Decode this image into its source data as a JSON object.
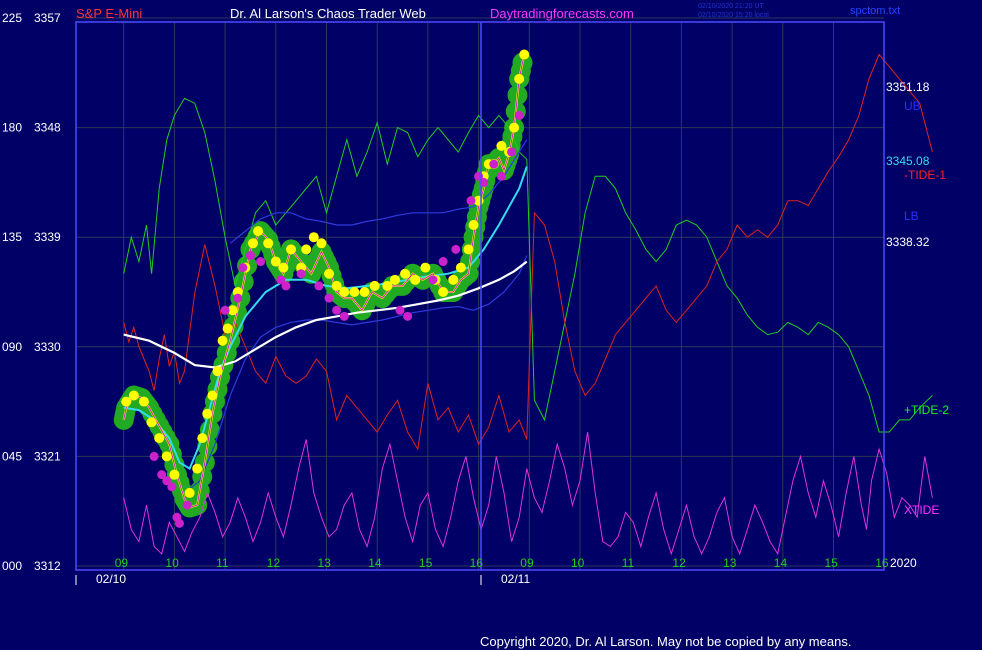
{
  "header": {
    "instrument": "S&P E-Mini",
    "site_title": "Dr. Al Larson's Chaos Trader Web",
    "site_url": "Daytradingforecasts.com",
    "timestamp_line1": "02/10/2020 21:20 UT",
    "timestamp_line2": "02/10/2020 15:20 local",
    "file_name": "spctom.txt"
  },
  "footer": {
    "copyright": "Copyright 2020, Dr. Al Larson. May not be copied by any means."
  },
  "colors": {
    "background": "#000066",
    "grid": "#2a3a5a",
    "axis": "#4b4bff",
    "price": "#ffff00",
    "bubble": "#22aa22",
    "ema_fast": "#33ddee",
    "ema_slow": "#ffffff",
    "band": "#2d3bdd",
    "tide_plus": "#22cc22",
    "tide_minus": "#dd2222",
    "xtide": "#dd33dd",
    "magenta_marker": "#cc22cc"
  },
  "chart_data": {
    "type": "line",
    "left_axis_osc": [
      "225",
      "180",
      "135",
      "090",
      "045",
      "000"
    ],
    "left_axis_price": [
      "3357",
      "3348",
      "3339",
      "3330",
      "3321",
      "3312"
    ],
    "ylim_price": [
      3312,
      3357
    ],
    "ylim_osc": [
      0,
      225
    ],
    "x_hours_day1": [
      "09",
      "10",
      "11",
      "12",
      "13",
      "14",
      "15",
      "16"
    ],
    "x_hours_day2": [
      "09",
      "10",
      "11",
      "12",
      "13",
      "14",
      "15",
      "16"
    ],
    "date_labels": [
      "02/10",
      "02/11"
    ],
    "year_label": "2020",
    "right_labels": {
      "upper_band_value": "3351.18",
      "upper_band_name": "UB",
      "mid_value": "3345.08",
      "tide_minus_name": "-TIDE-1",
      "lower_band_name": "LB",
      "lower_band_value": "3338.32",
      "tide_plus_name": "+TIDE-2",
      "xtide_name": "XTIDE"
    },
    "series": [
      {
        "key": "price",
        "x": [
          0,
          0.05,
          0.2,
          0.35,
          0.5,
          0.7,
          0.9,
          1.05,
          1.2,
          1.3,
          1.45,
          1.6,
          1.75,
          1.9,
          2.1,
          2.3,
          2.5,
          2.7,
          2.85,
          3.0,
          3.15,
          3.3,
          3.5,
          3.7,
          3.9,
          4.05,
          4.2,
          4.35,
          4.5,
          4.7,
          4.9,
          5.1,
          5.3,
          5.5,
          5.7,
          5.9,
          6.1,
          6.3,
          6.5,
          6.65,
          6.8,
          6.9,
          7.0,
          7.1,
          7.2,
          7.3,
          7.4,
          7.5,
          7.6,
          7.7,
          7.8,
          7.9
        ],
        "values": [
          3324.0,
          3325.0,
          3326.0,
          3325.8,
          3325.0,
          3323.5,
          3322.0,
          3319.5,
          3317.5,
          3316.8,
          3317.0,
          3320.5,
          3324.5,
          3327.5,
          3330.5,
          3334.0,
          3338.0,
          3339.5,
          3338.8,
          3337.0,
          3336.0,
          3338.0,
          3337.0,
          3336.0,
          3337.8,
          3336.5,
          3334.5,
          3334.0,
          3334.0,
          3333.0,
          3334.5,
          3334.0,
          3335.0,
          3335.0,
          3336.0,
          3335.5,
          3336.0,
          3334.5,
          3334.5,
          3335.5,
          3336.0,
          3339.0,
          3341.5,
          3343.0,
          3345.0,
          3345.0,
          3345.5,
          3344.5,
          3345.8,
          3348.0,
          3352.0,
          3354.0
        ]
      },
      {
        "key": "ema_fast",
        "x": [
          0,
          0.3,
          0.6,
          0.9,
          1.1,
          1.3,
          1.5,
          1.7,
          1.9,
          2.1,
          2.4,
          2.8,
          3.2,
          3.6,
          4.0,
          4.4,
          4.8,
          5.2,
          5.6,
          6.0,
          6.4,
          6.8,
          7.1,
          7.4,
          7.6,
          7.8,
          7.95
        ],
        "values": [
          3325.0,
          3324.8,
          3324.0,
          3322.5,
          3320.5,
          3320.0,
          3322.0,
          3325.0,
          3328.0,
          3330.0,
          3332.5,
          3334.5,
          3335.5,
          3335.5,
          3335.0,
          3334.8,
          3335.0,
          3335.2,
          3335.5,
          3335.8,
          3336.0,
          3336.5,
          3338.0,
          3340.0,
          3341.5,
          3343.0,
          3344.8
        ]
      },
      {
        "key": "ema_slow",
        "x": [
          0,
          0.5,
          1.0,
          1.4,
          1.8,
          2.2,
          2.6,
          3.0,
          3.4,
          3.8,
          4.2,
          4.6,
          5.0,
          5.4,
          5.8,
          6.2,
          6.6,
          7.0,
          7.4,
          7.7,
          7.95
        ],
        "values": [
          3331.0,
          3330.5,
          3329.5,
          3328.5,
          3328.3,
          3328.8,
          3329.8,
          3330.8,
          3331.6,
          3332.2,
          3332.5,
          3332.8,
          3333.0,
          3333.2,
          3333.5,
          3333.8,
          3334.2,
          3334.8,
          3335.5,
          3336.2,
          3337.0
        ]
      },
      {
        "key": "band_upper",
        "x": [
          2.1,
          2.4,
          2.7,
          3.0,
          3.3,
          3.6,
          3.9,
          4.2,
          4.5,
          4.8,
          5.1,
          5.4,
          5.7,
          6.0,
          6.3,
          6.6,
          6.9,
          7.2,
          7.5,
          7.8,
          7.95
        ],
        "values": [
          3338.5,
          3339.5,
          3340.5,
          3341.0,
          3341.0,
          3340.5,
          3340.3,
          3340.0,
          3340.0,
          3340.3,
          3340.5,
          3340.8,
          3341.0,
          3341.0,
          3341.0,
          3341.3,
          3341.5,
          3342.5,
          3344.0,
          3346.0,
          3347.0
        ]
      },
      {
        "key": "band_lower",
        "x": [
          1.2,
          1.5,
          1.8,
          2.1,
          2.4,
          2.7,
          3.0,
          3.3,
          3.6,
          3.9,
          4.2,
          4.5,
          4.8,
          5.1,
          5.4,
          5.7,
          6.0,
          6.3,
          6.6,
          6.9,
          7.2,
          7.5,
          7.8,
          7.95
        ],
        "values": [
          3318.0,
          3319.0,
          3322.0,
          3326.0,
          3329.0,
          3330.8,
          3331.6,
          3332.0,
          3332.2,
          3332.2,
          3332.0,
          3331.8,
          3332.0,
          3332.2,
          3332.5,
          3332.8,
          3333.0,
          3333.2,
          3333.3,
          3333.0,
          3333.5,
          3334.5,
          3336.0,
          3337.5
        ]
      },
      {
        "key": "tide_plus",
        "x": [
          0,
          0.15,
          0.3,
          0.45,
          0.55,
          0.7,
          0.85,
          1.0,
          1.2,
          1.4,
          1.6,
          1.8,
          2.0,
          2.2,
          2.4,
          2.6,
          2.8,
          3.0,
          3.2,
          3.4,
          3.6,
          3.8,
          4.0,
          4.2,
          4.4,
          4.6,
          4.8,
          5.0,
          5.2,
          5.4,
          5.6,
          5.8,
          6.0,
          6.2,
          6.4,
          6.6,
          6.8,
          7.0,
          7.2,
          7.4,
          7.6,
          7.8,
          7.95,
          8.1,
          8.3,
          8.5,
          8.7,
          8.9,
          9.1,
          9.3,
          9.5,
          9.7,
          9.9,
          10.1,
          10.3,
          10.5,
          10.7,
          10.9,
          11.1,
          11.3,
          11.5,
          11.7,
          11.9,
          12.1,
          12.3,
          12.5,
          12.7,
          12.9,
          13.1,
          13.3,
          13.5,
          13.7,
          13.9,
          14.1,
          14.3,
          14.5,
          14.7,
          14.9,
          15.1,
          15.3,
          15.5,
          15.7,
          15.95
        ],
        "values": [
          120,
          135,
          125,
          140,
          120,
          155,
          175,
          185,
          192,
          190,
          178,
          158,
          135,
          115,
          130,
          145,
          150,
          140,
          145,
          150,
          155,
          160,
          145,
          160,
          175,
          160,
          170,
          182,
          165,
          180,
          178,
          168,
          175,
          180,
          175,
          170,
          178,
          185,
          180,
          185,
          180,
          170,
          167,
          68,
          60,
          80,
          100,
          120,
          145,
          160,
          160,
          155,
          145,
          138,
          130,
          125,
          130,
          140,
          142,
          140,
          135,
          125,
          115,
          110,
          103,
          98,
          95,
          96,
          100,
          98,
          95,
          100,
          98,
          95,
          90,
          80,
          70,
          55,
          55,
          60,
          60,
          65,
          70
        ],
        "ylim": [
          0,
          225
        ]
      },
      {
        "key": "tide_minus",
        "x": [
          0,
          0.1,
          0.2,
          0.3,
          0.4,
          0.5,
          0.6,
          0.7,
          0.8,
          0.9,
          1.0,
          1.1,
          1.2,
          1.4,
          1.6,
          1.8,
          2.0,
          2.2,
          2.4,
          2.6,
          2.8,
          3.0,
          3.2,
          3.4,
          3.6,
          3.8,
          4.0,
          4.2,
          4.4,
          4.6,
          4.8,
          5.0,
          5.2,
          5.4,
          5.6,
          5.8,
          6.0,
          6.2,
          6.4,
          6.6,
          6.8,
          7.0,
          7.2,
          7.4,
          7.6,
          7.8,
          7.95,
          8.1,
          8.3,
          8.5,
          8.7,
          8.9,
          9.1,
          9.3,
          9.5,
          9.7,
          9.9,
          10.1,
          10.3,
          10.5,
          10.7,
          10.9,
          11.1,
          11.3,
          11.5,
          11.7,
          11.9,
          12.1,
          12.3,
          12.5,
          12.7,
          12.9,
          13.1,
          13.3,
          13.5,
          13.7,
          13.9,
          14.1,
          14.3,
          14.5,
          14.7,
          14.9,
          15.1,
          15.3,
          15.5,
          15.7,
          15.95
        ],
        "values": [
          100,
          92,
          98,
          90,
          85,
          80,
          72,
          85,
          95,
          82,
          88,
          75,
          80,
          112,
          132,
          115,
          95,
          100,
          90,
          80,
          75,
          86,
          78,
          75,
          78,
          85,
          80,
          60,
          70,
          65,
          60,
          55,
          62,
          68,
          55,
          48,
          75,
          60,
          65,
          55,
          62,
          50,
          57,
          70,
          55,
          60,
          52,
          145,
          140,
          125,
          100,
          80,
          70,
          75,
          85,
          95,
          100,
          105,
          110,
          115,
          105,
          100,
          105,
          110,
          115,
          125,
          130,
          140,
          135,
          138,
          135,
          140,
          150,
          150,
          148,
          155,
          162,
          168,
          175,
          185,
          200,
          210,
          205,
          200,
          195,
          190,
          170
        ],
        "ylim": [
          0,
          225
        ]
      },
      {
        "key": "xtide",
        "x": [
          0,
          0.15,
          0.3,
          0.45,
          0.6,
          0.75,
          0.9,
          1.05,
          1.2,
          1.35,
          1.5,
          1.65,
          1.8,
          1.95,
          2.1,
          2.25,
          2.4,
          2.55,
          2.7,
          2.85,
          3.0,
          3.15,
          3.3,
          3.45,
          3.6,
          3.75,
          3.9,
          4.05,
          4.2,
          4.35,
          4.5,
          4.65,
          4.8,
          4.95,
          5.1,
          5.25,
          5.4,
          5.55,
          5.7,
          5.85,
          6.0,
          6.15,
          6.3,
          6.45,
          6.6,
          6.75,
          6.9,
          7.05,
          7.2,
          7.35,
          7.5,
          7.65,
          7.8,
          7.95,
          8.1,
          8.25,
          8.4,
          8.55,
          8.7,
          8.85,
          9.0,
          9.15,
          9.3,
          9.45,
          9.6,
          9.75,
          9.9,
          10.05,
          10.2,
          10.35,
          10.5,
          10.65,
          10.8,
          10.95,
          11.1,
          11.25,
          11.4,
          11.55,
          11.7,
          11.85,
          12.0,
          12.15,
          12.3,
          12.45,
          12.6,
          12.75,
          12.9,
          13.05,
          13.2,
          13.35,
          13.5,
          13.65,
          13.8,
          13.95,
          14.1,
          14.25,
          14.4,
          14.55,
          14.65,
          14.75,
          14.9,
          15.05,
          15.2,
          15.35,
          15.5,
          15.65,
          15.8,
          15.95
        ],
        "values": [
          28,
          15,
          10,
          25,
          8,
          5,
          18,
          12,
          6,
          14,
          20,
          30,
          22,
          12,
          18,
          28,
          20,
          10,
          18,
          30,
          20,
          12,
          25,
          40,
          52,
          30,
          20,
          12,
          15,
          25,
          30,
          15,
          8,
          20,
          40,
          50,
          35,
          20,
          10,
          25,
          30,
          15,
          8,
          20,
          35,
          45,
          28,
          15,
          25,
          45,
          30,
          10,
          20,
          40,
          28,
          22,
          35,
          50,
          40,
          25,
          35,
          55,
          30,
          10,
          8,
          12,
          22,
          18,
          8,
          20,
          30,
          15,
          5,
          15,
          25,
          12,
          5,
          12,
          22,
          28,
          12,
          5,
          15,
          25,
          18,
          10,
          5,
          20,
          35,
          45,
          30,
          20,
          35,
          25,
          12,
          30,
          45,
          25,
          15,
          35,
          48,
          38,
          20,
          28,
          25,
          20,
          45,
          28
        ],
        "ylim": [
          0,
          225
        ]
      }
    ],
    "magenta_markers_price": [
      [
        0.6,
        3321.0
      ],
      [
        0.75,
        3319.5
      ],
      [
        0.85,
        3319.0
      ],
      [
        0.95,
        3318.5
      ],
      [
        1.05,
        3316.0
      ],
      [
        1.1,
        3315.5
      ],
      [
        1.25,
        3317.0
      ],
      [
        2.0,
        3333.0
      ],
      [
        2.25,
        3334.0
      ],
      [
        2.35,
        3336.5
      ],
      [
        2.5,
        3337.5
      ],
      [
        2.7,
        3337.0
      ],
      [
        3.1,
        3335.5
      ],
      [
        3.2,
        3335.0
      ],
      [
        3.5,
        3336.0
      ],
      [
        3.85,
        3335.0
      ],
      [
        4.05,
        3334.0
      ],
      [
        4.2,
        3333.0
      ],
      [
        4.35,
        3332.5
      ],
      [
        5.45,
        3333.0
      ],
      [
        5.6,
        3332.5
      ],
      [
        6.1,
        3335.5
      ],
      [
        6.3,
        3337.0
      ],
      [
        6.55,
        3338.0
      ],
      [
        6.85,
        3342.0
      ],
      [
        7.0,
        3344.0
      ],
      [
        7.1,
        3343.5
      ],
      [
        7.3,
        3345.0
      ],
      [
        7.45,
        3344.0
      ],
      [
        7.65,
        3346.0
      ],
      [
        7.8,
        3349.0
      ]
    ],
    "yellow_markers_price": [
      [
        0.05,
        3325.5
      ],
      [
        0.2,
        3326.0
      ],
      [
        0.4,
        3325.5
      ],
      [
        0.55,
        3323.8
      ],
      [
        0.7,
        3322.5
      ],
      [
        0.85,
        3321.0
      ],
      [
        1.0,
        3319.5
      ],
      [
        1.3,
        3318.0
      ],
      [
        1.45,
        3320.0
      ],
      [
        1.55,
        3322.5
      ],
      [
        1.65,
        3324.5
      ],
      [
        1.75,
        3326.0
      ],
      [
        1.85,
        3328.0
      ],
      [
        1.95,
        3330.5
      ],
      [
        2.05,
        3331.5
      ],
      [
        2.15,
        3333.0
      ],
      [
        2.25,
        3334.5
      ],
      [
        2.4,
        3336.5
      ],
      [
        2.55,
        3338.5
      ],
      [
        2.65,
        3339.5
      ],
      [
        2.85,
        3338.5
      ],
      [
        3.0,
        3337.0
      ],
      [
        3.15,
        3336.5
      ],
      [
        3.3,
        3338.0
      ],
      [
        3.5,
        3336.5
      ],
      [
        3.6,
        3338.0
      ],
      [
        3.75,
        3339.0
      ],
      [
        3.9,
        3338.5
      ],
      [
        4.05,
        3336.0
      ],
      [
        4.2,
        3335.0
      ],
      [
        4.35,
        3334.5
      ],
      [
        4.55,
        3334.5
      ],
      [
        4.75,
        3334.5
      ],
      [
        4.95,
        3335.0
      ],
      [
        5.2,
        3335.0
      ],
      [
        5.35,
        3335.5
      ],
      [
        5.55,
        3336.0
      ],
      [
        5.75,
        3335.5
      ],
      [
        5.95,
        3336.5
      ],
      [
        6.15,
        3335.5
      ],
      [
        6.3,
        3334.5
      ],
      [
        6.5,
        3335.5
      ],
      [
        6.65,
        3336.5
      ],
      [
        6.8,
        3338.0
      ],
      [
        6.9,
        3340.0
      ],
      [
        7.0,
        3342.0
      ],
      [
        7.1,
        3344.0
      ],
      [
        7.2,
        3345.0
      ],
      [
        7.3,
        3345.0
      ],
      [
        7.45,
        3346.5
      ],
      [
        7.6,
        3346.0
      ],
      [
        7.7,
        3348.0
      ],
      [
        7.8,
        3352.0
      ],
      [
        7.9,
        3354.0
      ]
    ]
  }
}
